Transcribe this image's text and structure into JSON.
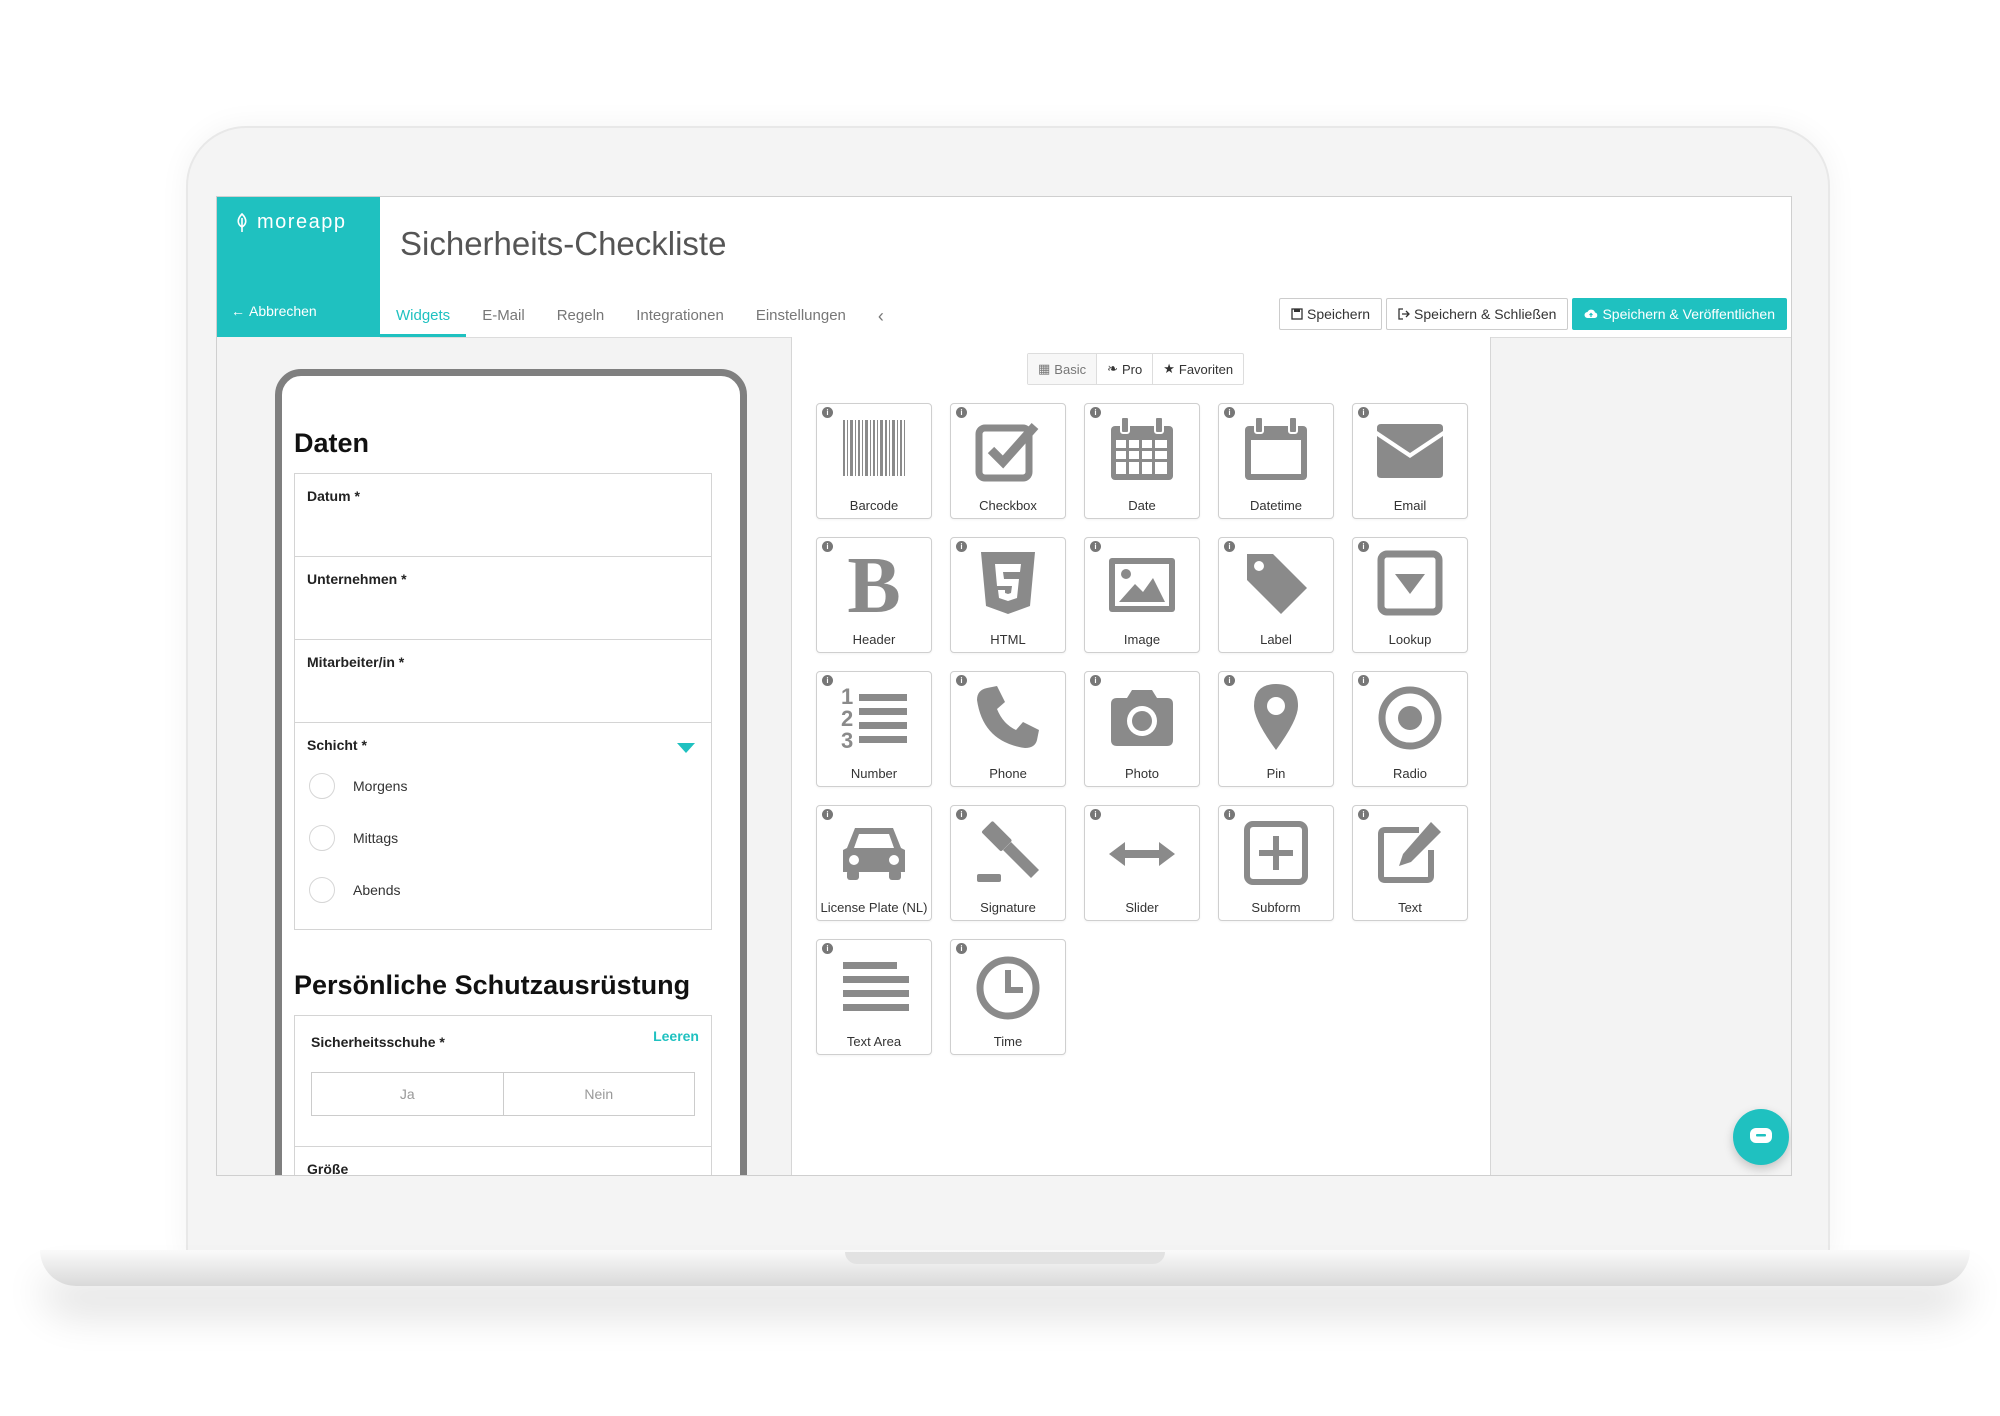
{
  "brand": {
    "logo_text": "moreapp",
    "back_label": "Abbrechen"
  },
  "header": {
    "title": "Sicherheits-Checkliste"
  },
  "tabs": [
    {
      "label": "Widgets",
      "active": true
    },
    {
      "label": "E-Mail",
      "active": false
    },
    {
      "label": "Regeln",
      "active": false
    },
    {
      "label": "Integrationen",
      "active": false
    },
    {
      "label": "Einstellungen",
      "active": false
    }
  ],
  "actions": {
    "save": "Speichern",
    "save_close": "Speichern & Schließen",
    "save_publish": "Speichern & Veröffentlichen"
  },
  "form": {
    "section1": "Daten",
    "fields": [
      {
        "label": "Datum *"
      },
      {
        "label": "Unternehmen *"
      },
      {
        "label": "Mitarbeiter/in *"
      }
    ],
    "shift": {
      "label": "Schicht *",
      "options": [
        "Morgens",
        "Mittags",
        "Abends"
      ]
    },
    "section2": "Persönliche Schutzausrüstung",
    "shoes": {
      "label": "Sicherheitsschuhe *",
      "clear": "Leeren",
      "yes": "Ja",
      "no": "Nein"
    },
    "size_label": "Größe"
  },
  "filters": {
    "basic": "Basic",
    "pro": "Pro",
    "favorites": "Favoriten"
  },
  "widgets": [
    {
      "label": "Barcode",
      "icon": "barcode-icon"
    },
    {
      "label": "Checkbox",
      "icon": "checkbox-icon"
    },
    {
      "label": "Date",
      "icon": "calendar-icon"
    },
    {
      "label": "Datetime",
      "icon": "calendar-blank-icon"
    },
    {
      "label": "Email",
      "icon": "envelope-icon"
    },
    {
      "label": "Header",
      "icon": "bold-b-icon"
    },
    {
      "label": "HTML",
      "icon": "html5-icon"
    },
    {
      "label": "Image",
      "icon": "image-icon"
    },
    {
      "label": "Label",
      "icon": "tag-icon"
    },
    {
      "label": "Lookup",
      "icon": "dropdown-box-icon"
    },
    {
      "label": "Number",
      "icon": "numbered-list-icon"
    },
    {
      "label": "Phone",
      "icon": "phone-icon"
    },
    {
      "label": "Photo",
      "icon": "camera-icon"
    },
    {
      "label": "Pin",
      "icon": "map-pin-icon"
    },
    {
      "label": "Radio",
      "icon": "radio-dot-icon"
    },
    {
      "label": "License Plate (NL)",
      "icon": "car-icon"
    },
    {
      "label": "Signature",
      "icon": "gavel-icon"
    },
    {
      "label": "Slider",
      "icon": "double-arrow-icon"
    },
    {
      "label": "Subform",
      "icon": "plus-square-icon"
    },
    {
      "label": "Text",
      "icon": "pencil-square-icon"
    },
    {
      "label": "Text Area",
      "icon": "lines-icon"
    },
    {
      "label": "Time",
      "icon": "clock-icon"
    }
  ],
  "colors": {
    "accent": "#1fc1c0",
    "icon_gray": "#8a8a8a"
  }
}
